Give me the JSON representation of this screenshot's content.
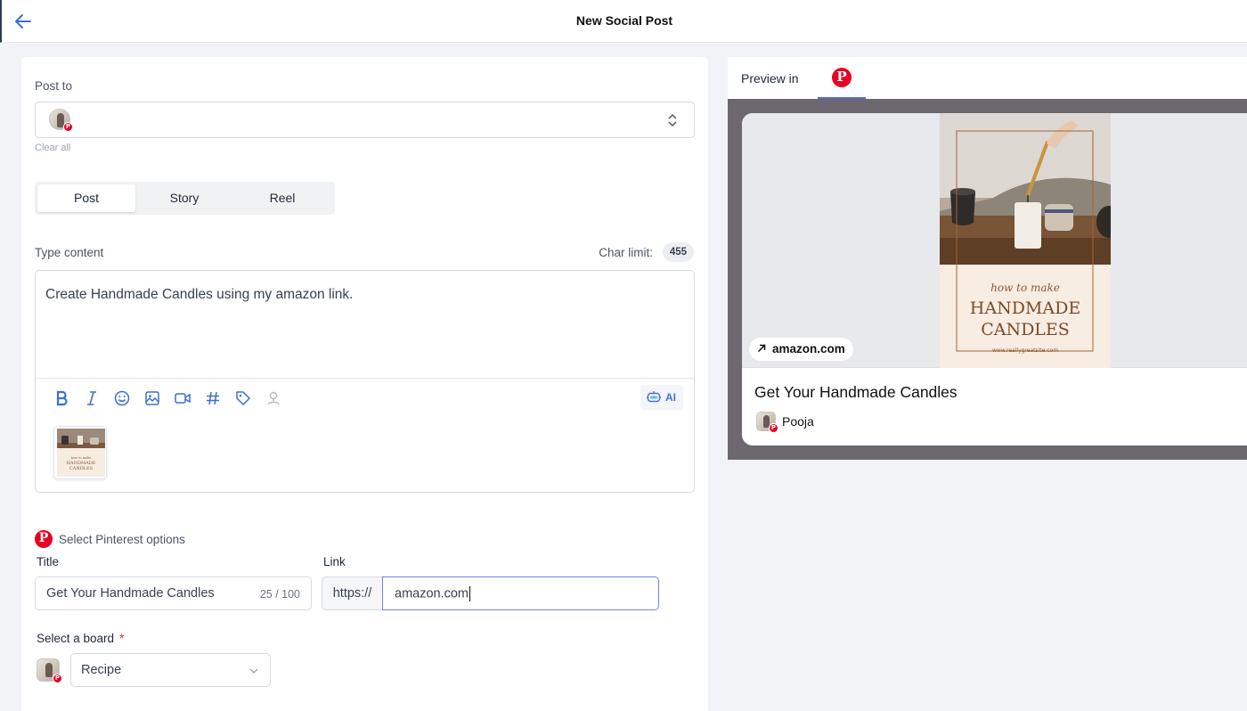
{
  "header": {
    "title": "New Social Post",
    "back_icon": "arrow-left-icon"
  },
  "post_to": {
    "label": "Post to",
    "clear_all": "Clear all",
    "account_network": "pinterest"
  },
  "post_type_tabs": [
    {
      "label": "Post",
      "active": true
    },
    {
      "label": "Story",
      "active": false
    },
    {
      "label": "Reel",
      "active": false
    }
  ],
  "content": {
    "label": "Type content",
    "char_limit_label": "Char limit:",
    "char_limit_value": "455",
    "text": "Create Handmade Candles using my amazon link.",
    "toolbar": [
      "bold-icon",
      "italic-icon",
      "emoji-icon",
      "image-icon",
      "video-icon",
      "hashtag-icon",
      "tag-icon",
      "location-person-icon"
    ],
    "ai_label": "AI"
  },
  "pinterest_options": {
    "heading": "Select Pinterest options",
    "title_label": "Title",
    "title_value": "Get Your Handmade Candles",
    "title_counter": "25 / 100",
    "link_label": "Link",
    "link_prefix": "https://",
    "link_value": "amazon.com",
    "board_label": "Select a board",
    "board_required": "*",
    "board_value": "Recipe"
  },
  "preview": {
    "label": "Preview in",
    "network": "pinterest",
    "domain": "amazon.com",
    "pin_title": "Get Your Handmade Candles",
    "author": "Pooja",
    "art_lines": [
      "how to make",
      "HANDMADE",
      "CANDLES",
      "www.reallygreatsite.com"
    ]
  },
  "colors": {
    "accent": "#4f6bd8",
    "pinterest_red": "#e60023",
    "preview_bg": "#6d6870"
  }
}
